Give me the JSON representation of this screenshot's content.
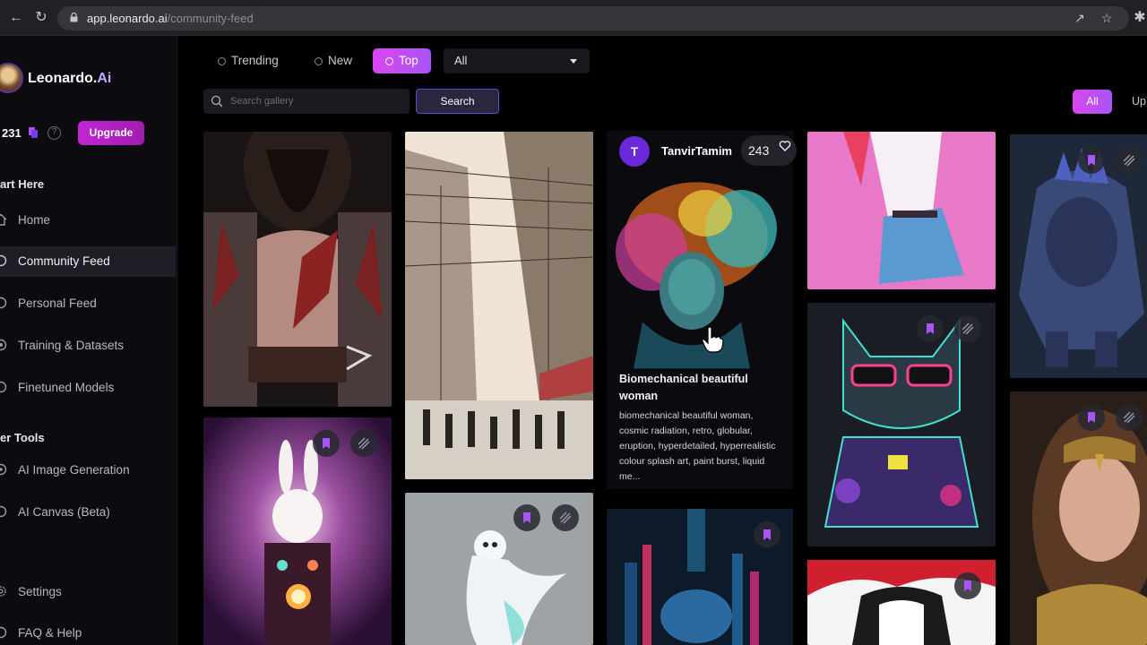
{
  "browser": {
    "url_host": "app.leonardo.ai",
    "url_path": "/community-feed"
  },
  "sidebar": {
    "brand_name": "Leonardo.",
    "brand_suffix": "Ai",
    "token_count": "231",
    "upgrade_label": "Upgrade",
    "section_start": "art Here",
    "section_tools": "er Tools",
    "nav": [
      {
        "label": "Home"
      },
      {
        "label": "Community Feed"
      },
      {
        "label": "Personal Feed"
      },
      {
        "label": "Training & Datasets"
      },
      {
        "label": "Finetuned Models"
      },
      {
        "label": "AI Image Generation"
      },
      {
        "label": "AI Canvas (Beta)"
      },
      {
        "label": "Settings"
      },
      {
        "label": "FAQ & Help"
      }
    ]
  },
  "toolbar": {
    "tabs": [
      {
        "label": "Trending"
      },
      {
        "label": "New"
      },
      {
        "label": "Top"
      }
    ],
    "filter_value": "All",
    "search_placeholder": "Search gallery",
    "search_button": "Search",
    "chip_all": "All",
    "chip_next": "Up"
  },
  "hover_card": {
    "avatar_letter": "T",
    "username": "TanvirTamim",
    "like_count": "243",
    "title": "Biomechanical beautiful woman",
    "prompt": "biomechanical beautiful woman, cosmic radiation, retro, globular, eruption, hyperdetailed, hyperrealistic colour splash art, paint burst, liquid me..."
  },
  "colors": {
    "accent": "#c026d3",
    "accent_purple": "#a855f7",
    "sidebar_bg": "#0b0b10",
    "active_item_bg": "#1e1e26"
  },
  "icons": [
    "lock-icon",
    "back-arrow-icon",
    "reload-icon",
    "share-icon",
    "star-icon",
    "extensions-icon",
    "token-icon",
    "help-icon",
    "home-icon",
    "community-icon",
    "personal-icon",
    "training-icon",
    "finetuned-icon",
    "image-gen-icon",
    "canvas-icon",
    "settings-icon",
    "faq-icon",
    "search-icon",
    "heart-icon",
    "bookmark-icon",
    "remix-icon",
    "caret-down-icon"
  ]
}
